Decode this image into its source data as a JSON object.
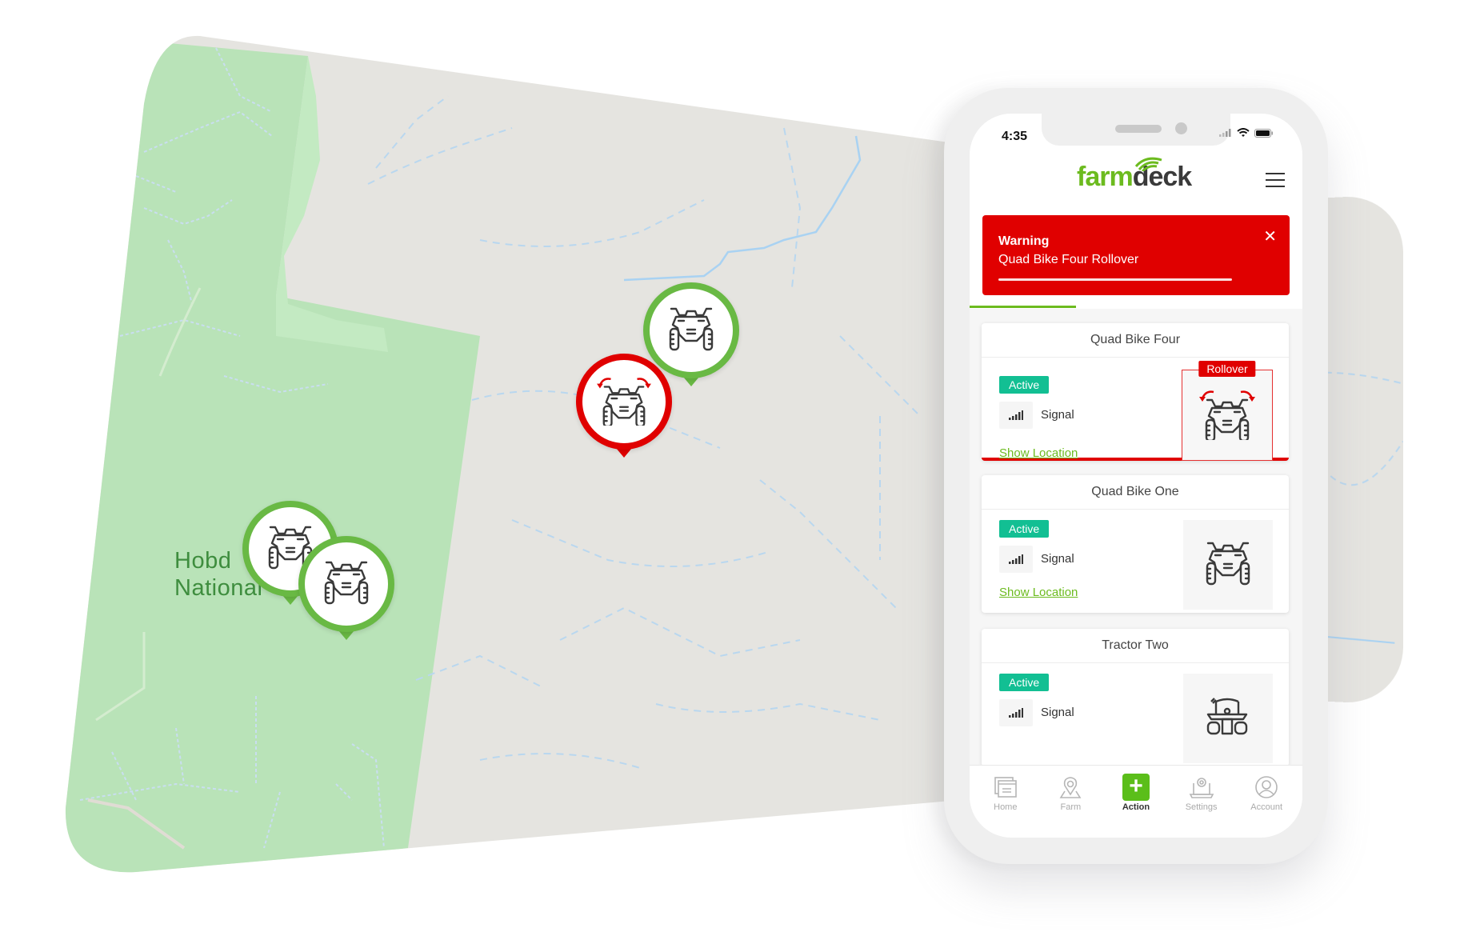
{
  "map": {
    "label_line1": "Hobday",
    "label_line2": "National Park",
    "label_visible_line1": "Hobd",
    "label_visible_line2": "National",
    "colors": {
      "land": "#e5e4e0",
      "park": "#b9e3b8",
      "water": "#a9d2f2"
    },
    "pins": [
      {
        "name": "quad-bike-pin-1",
        "status": "normal"
      },
      {
        "name": "quad-bike-pin-2",
        "status": "normal"
      },
      {
        "name": "quad-bike-four-pin",
        "status": "rollover"
      },
      {
        "name": "quad-bike-one-pin",
        "status": "normal"
      }
    ]
  },
  "phone": {
    "status_bar": {
      "time": "4:35"
    },
    "header": {
      "logo_farm": "farm",
      "logo_deck": "deck"
    },
    "warning": {
      "title": "Warning",
      "message": "Quad Bike Four Rollover",
      "close": "✕",
      "progress": 0.85
    },
    "tab_progress": 0.32,
    "devices": [
      {
        "name": "Quad Bike Four",
        "status": "Active",
        "signal_label": "Signal",
        "link": "Show Location",
        "alert": "Rollover",
        "icon": "quad-bike-icon"
      },
      {
        "name": "Quad Bike One",
        "status": "Active",
        "signal_label": "Signal",
        "link": "Show Location",
        "icon": "quad-bike-icon"
      },
      {
        "name": "Tractor Two",
        "status": "Active",
        "signal_label": "Signal",
        "icon": "tractor-icon"
      }
    ],
    "nav": [
      {
        "label": "Home",
        "icon": "home-icon"
      },
      {
        "label": "Farm",
        "icon": "map-pin-icon"
      },
      {
        "label": "Action",
        "icon": "plus-icon",
        "symbol": "+",
        "active": true
      },
      {
        "label": "Settings",
        "icon": "settings-icon"
      },
      {
        "label": "Account",
        "icon": "account-icon"
      }
    ],
    "colors": {
      "brand_green": "#6cbb1f",
      "alert_red": "#e00000",
      "active_teal": "#12bf93"
    }
  }
}
